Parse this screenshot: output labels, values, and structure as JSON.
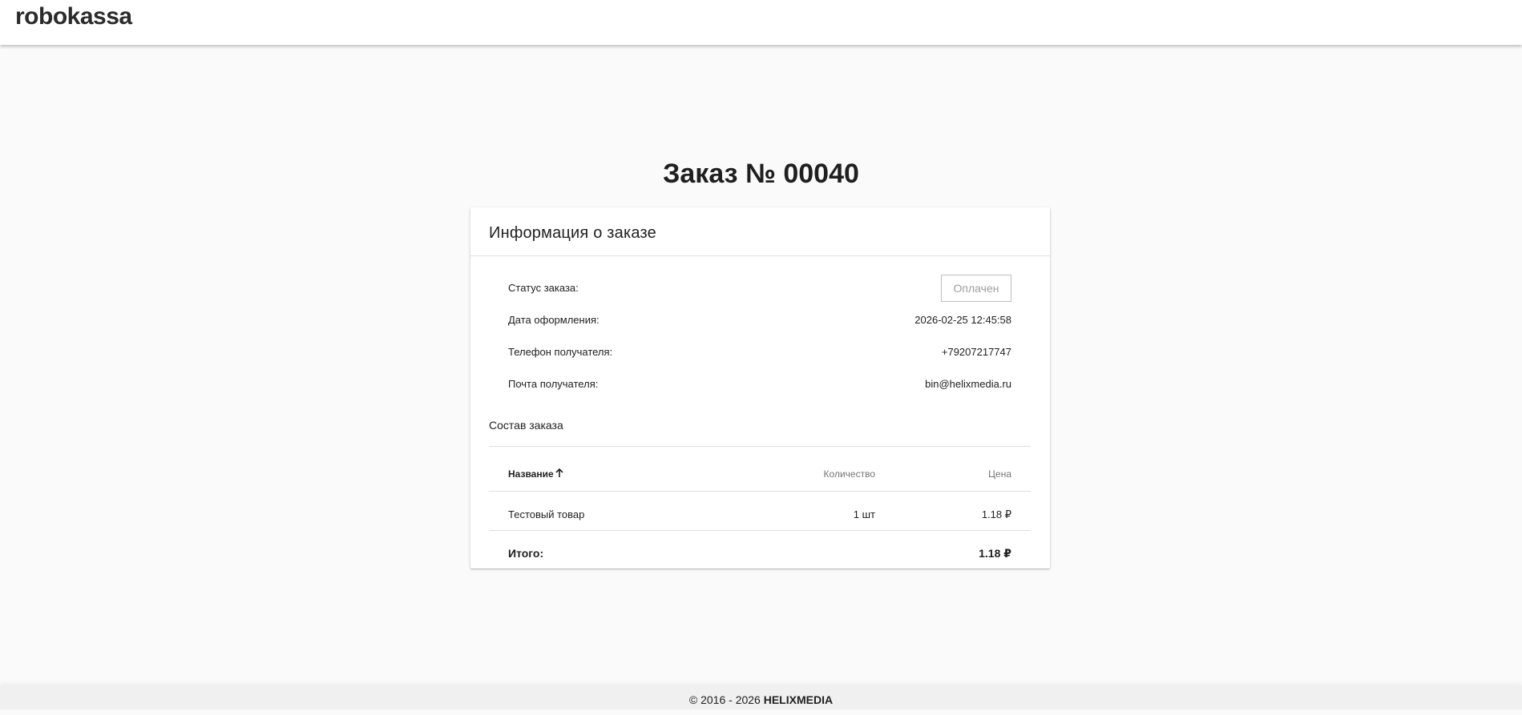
{
  "header": {
    "logo_text": "robokassa"
  },
  "page": {
    "title": "Заказ № 00040"
  },
  "card": {
    "title": "Информация о заказе",
    "info": {
      "status_label": "Статус заказа:",
      "status_value": "Оплачен",
      "date_label": "Дата оформления:",
      "date_value": "2026-02-25 12:45:58",
      "phone_label": "Телефон получателя:",
      "phone_value": "+79207217747",
      "email_label": "Почта получателя:",
      "email_value": "bin@helixmedia.ru"
    },
    "composition_title": "Состав заказа",
    "table": {
      "headers": {
        "name": "Название",
        "quantity": "Количество",
        "price": "Цена"
      },
      "rows": [
        {
          "name": "Тестовый товар",
          "quantity": "1 шт",
          "price": "1.18 ₽"
        }
      ],
      "total_label": "Итого:",
      "total_value": "1.18 ₽"
    }
  },
  "footer": {
    "copyright": "© 2016 - 2026 ",
    "company": "HELIXMEDIA"
  }
}
